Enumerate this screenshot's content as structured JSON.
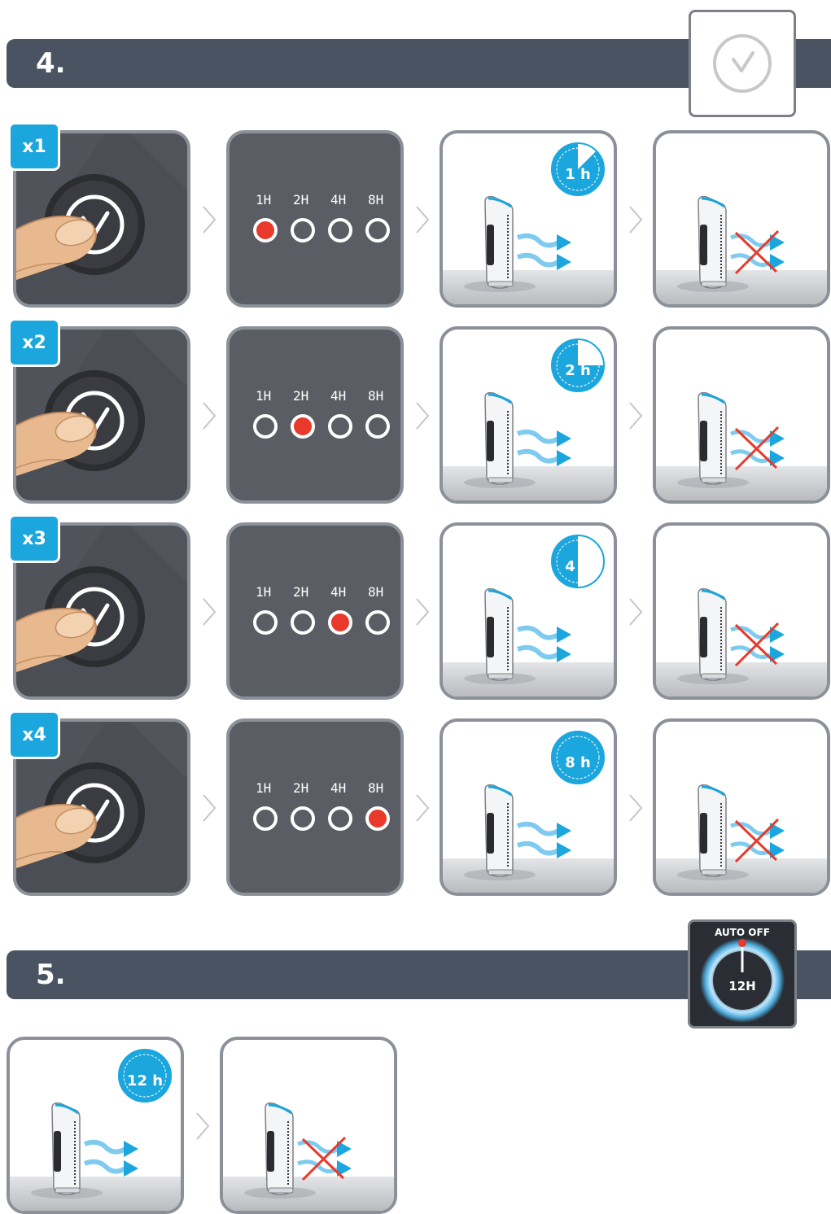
{
  "step4": {
    "number": "4.",
    "header_icon": "clock-icon",
    "rows": [
      {
        "press_count": "x1",
        "active_index": 0,
        "timer_label": "1 h",
        "fraction": 0.125
      },
      {
        "press_count": "x2",
        "active_index": 1,
        "timer_label": "2 h",
        "fraction": 0.25
      },
      {
        "press_count": "x3",
        "active_index": 2,
        "timer_label": "4 h",
        "fraction": 0.5
      },
      {
        "press_count": "x4",
        "active_index": 3,
        "timer_label": "8 h",
        "fraction": 1.0
      }
    ],
    "indicator_labels": [
      "1H",
      "2H",
      "4H",
      "8H"
    ]
  },
  "step5": {
    "number": "5.",
    "auto_off_label": "AUTO OFF",
    "auto_off_value": "12H",
    "timer_label": "12 h",
    "fraction": 1.0
  },
  "colors": {
    "banner": "#4a5361",
    "accent_blue": "#1ba6de",
    "led_red": "#e8392b",
    "tile_border": "#8b9099"
  }
}
